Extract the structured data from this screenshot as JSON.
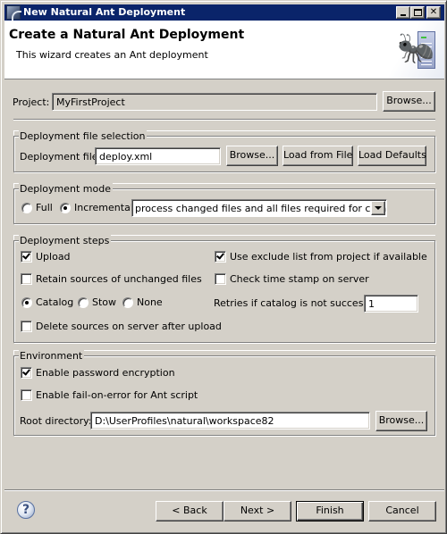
{
  "window": {
    "title": "New Natural Ant Deployment",
    "controls": {
      "minimize": "minimize",
      "maximize": "maximize",
      "close": "close"
    }
  },
  "header": {
    "title": "Create a Natural Ant Deployment",
    "description": "This wizard creates an Ant deployment",
    "image": "ant-server-icon"
  },
  "project": {
    "label": "Project:",
    "value": "MyFirstProject",
    "browse_label": "Browse..."
  },
  "file_selection": {
    "legend": "Deployment file selection",
    "label": "Deployment file:",
    "value": "deploy.xml",
    "browse_label": "Browse...",
    "load_from_file_label": "Load from File",
    "load_defaults_label": "Load Defaults"
  },
  "mode": {
    "legend": "Deployment mode",
    "options": [
      {
        "label": "Full",
        "selected": false
      },
      {
        "label": "Incremental",
        "selected": true
      }
    ],
    "dropdown_value": "process changed files and all files required for catalog"
  },
  "steps": {
    "legend": "Deployment steps",
    "upload": {
      "label": "Upload",
      "checked": true
    },
    "exclude_list": {
      "label": "Use exclude list from project if available",
      "checked": true
    },
    "retain_sources": {
      "label": "Retain sources of unchanged files",
      "checked": false
    },
    "check_timestamp": {
      "label": "Check time stamp on server",
      "checked": false
    },
    "compile_options": [
      {
        "label": "Catalog",
        "selected": true
      },
      {
        "label": "Stow",
        "selected": false
      },
      {
        "label": "None",
        "selected": false
      }
    ],
    "retries_label": "Retries if catalog is not successful",
    "retries_value": "1",
    "delete_sources": {
      "label": "Delete sources on server after upload",
      "checked": false
    }
  },
  "environment": {
    "legend": "Environment",
    "password_encryption": {
      "label": "Enable password encryption",
      "checked": true
    },
    "fail_on_error": {
      "label": "Enable fail-on-error for Ant script",
      "checked": false
    },
    "root_label": "Root directory:",
    "root_value": "D:\\UserProfiles\\natural\\workspace82",
    "browse_label": "Browse..."
  },
  "footer": {
    "help_glyph": "?",
    "back_label": "< Back",
    "next_label": "Next >",
    "finish_label": "Finish",
    "cancel_label": "Cancel"
  }
}
